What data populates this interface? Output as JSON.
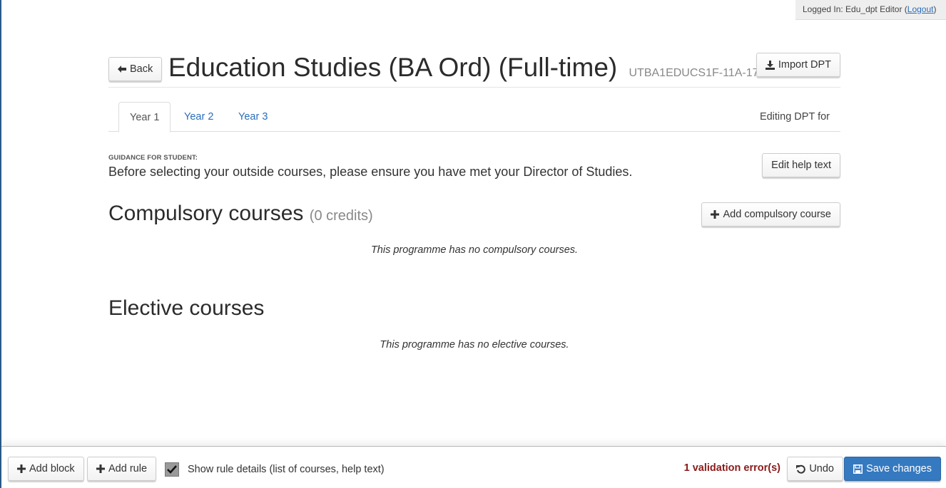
{
  "session": {
    "logged_in_prefix": "Logged In: Edu_dpt Editor (",
    "logout_label": "Logout",
    "logged_in_suffix": ")"
  },
  "header": {
    "back_label": "Back",
    "title": "Education Studies (BA Ord) (Full-time)",
    "code": "UTBA1EDUCS1F-11A-17",
    "import_label": "Import DPT"
  },
  "tabs": [
    {
      "label": "Year 1",
      "active": true
    },
    {
      "label": "Year 2",
      "active": false
    },
    {
      "label": "Year 3",
      "active": false
    }
  ],
  "editing_for": "Editing DPT for",
  "guidance": {
    "label": "GUIDANCE FOR STUDENT:",
    "text": "Before selecting your outside courses, please ensure you have met your Director of Studies.",
    "edit_label": "Edit help text"
  },
  "compulsory": {
    "title": "Compulsory courses",
    "credits": "(0 credits)",
    "add_label": "Add compulsory course",
    "empty_message": "This programme has no compulsory courses."
  },
  "elective": {
    "title": "Elective courses",
    "empty_message": "This programme has no elective courses."
  },
  "footer": {
    "add_block_label": "Add block",
    "add_rule_label": "Add rule",
    "show_rule_details_label": "Show rule details (list of courses, help text)",
    "show_rule_details_checked": true,
    "validation_message": "1 validation error(s)",
    "undo_label": "Undo",
    "save_label": "Save changes"
  },
  "colors": {
    "link": "#2a6ebb",
    "primary": "#3579c0",
    "error": "#8b1a1a"
  }
}
